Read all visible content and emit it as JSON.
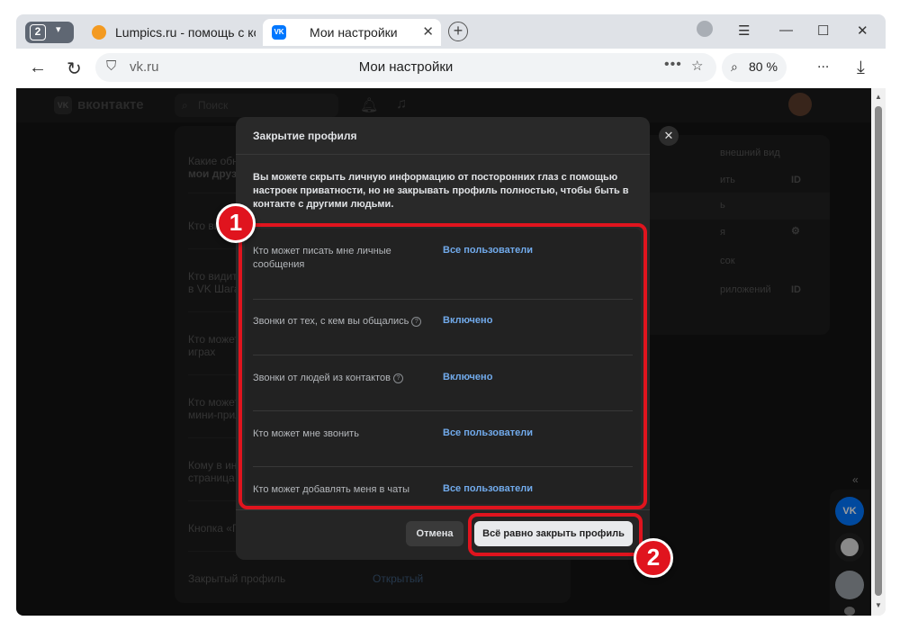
{
  "browser": {
    "tab_count": "2",
    "tabs": [
      {
        "label": "Lumpics.ru - помощь с ко",
        "close": "✕"
      },
      {
        "label": "Мои настройки",
        "close": "✕",
        "favicon": "VK"
      }
    ],
    "new_tab": "+",
    "url_host": "vk.ru",
    "page_title": "Мои настройки",
    "zoom": "80 %",
    "menu_dots": "..."
  },
  "vk": {
    "logo_text": "вконтакте",
    "logo_mark": "VK",
    "search_placeholder": "Поиск",
    "left_rows": [
      "Какие обн",
      "мои друзь",
      "Кто ви",
      "Кто видит",
      "в VK Шага",
      "Кто может",
      "играх",
      "Кто может",
      "мини-прил",
      "Кому в ин",
      "страница",
      "Кнопка «Г"
    ],
    "closed_profile_label": "Закрытый профиль",
    "closed_profile_value": "Открытый",
    "right_rows": [
      "внешний вид",
      "ить",
      "ь",
      "я",
      "сок",
      "риложений"
    ],
    "id_badge": "ID"
  },
  "modal": {
    "title": "Закрытие профиля",
    "description": "Вы можете скрыть личную информацию от посторонних глаз с помощью настроек приватности, но не закрывать профиль полностью, чтобы быть в контакте с другими людьми.",
    "settings": [
      {
        "label": "Кто может писать мне личные сообщения",
        "value": "Все пользователи",
        "help": false
      },
      {
        "label": "Звонки от тех, с кем вы общались",
        "value": "Включено",
        "help": true
      },
      {
        "label": "Звонки от людей из контактов",
        "value": "Включено",
        "help": true
      },
      {
        "label": "Кто может мне звонить",
        "value": "Все пользователи",
        "help": false
      },
      {
        "label": "Кто может добавлять меня в чаты",
        "value": "Все пользователи",
        "help": false
      }
    ],
    "cancel_label": "Отмена",
    "confirm_label": "Всё равно закрыть профиль",
    "help_glyph": "?",
    "close_glyph": "✕"
  },
  "annotations": {
    "badge1": "1",
    "badge2": "2",
    "accent_color": "#e0141e"
  },
  "colors": {
    "link": "#71aaeb",
    "modal_bg": "#292929",
    "page_bg": "#141414"
  }
}
